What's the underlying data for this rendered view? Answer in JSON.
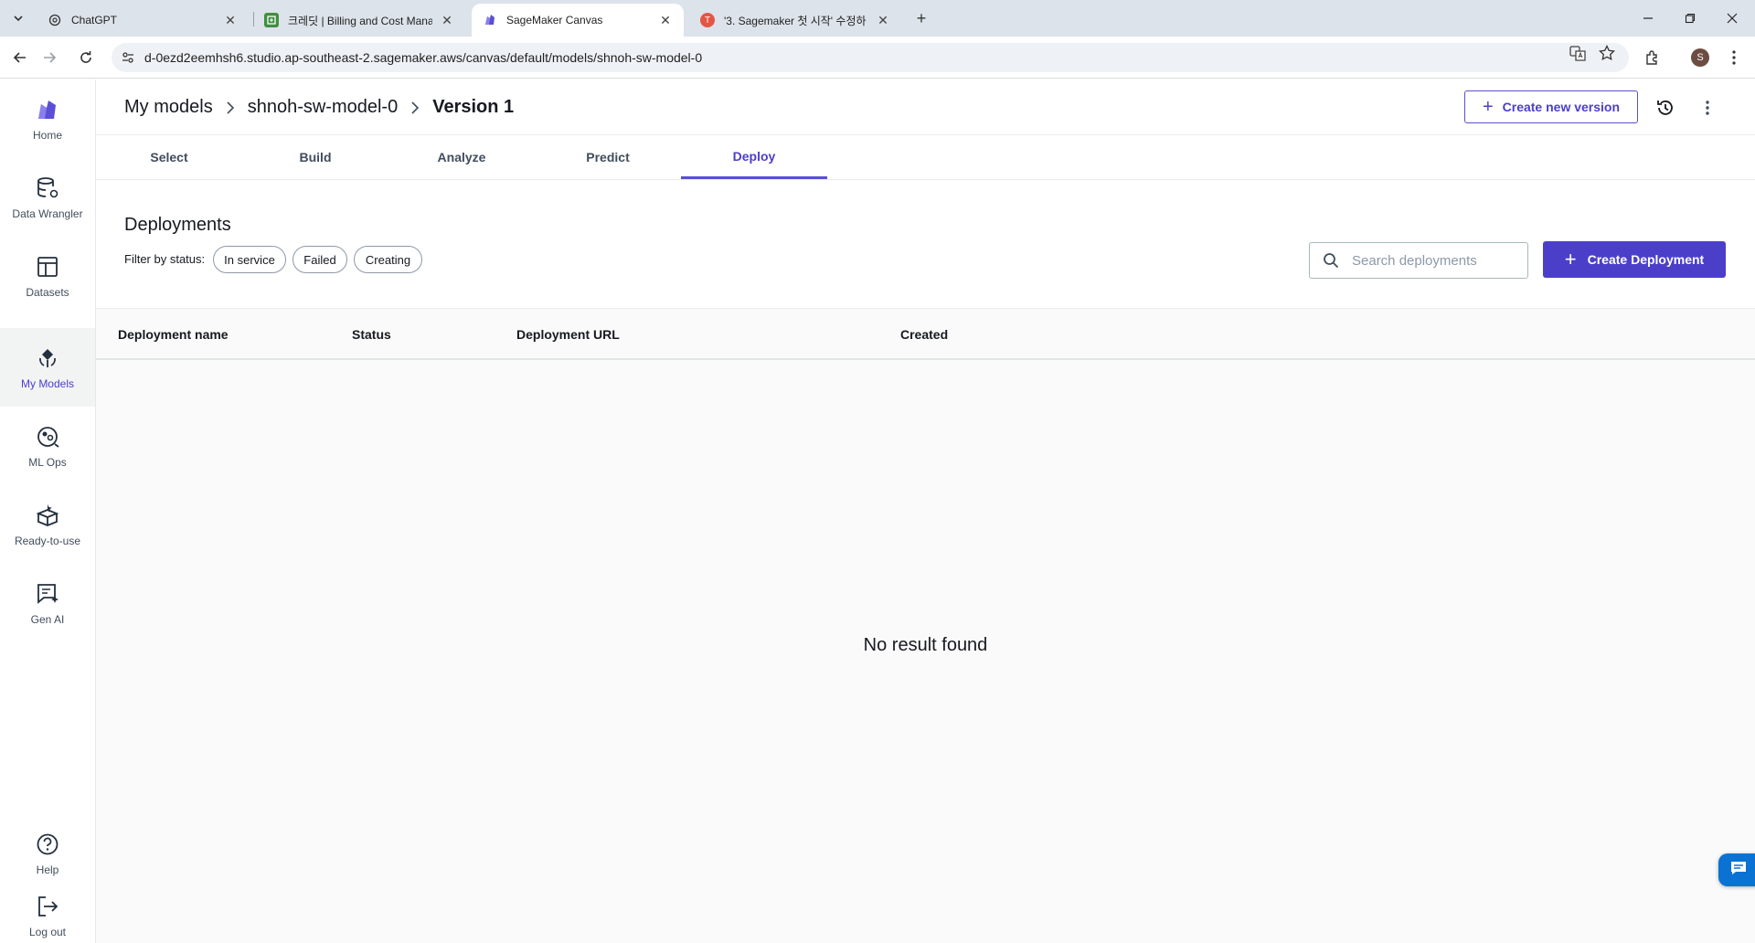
{
  "browser": {
    "tabs": [
      {
        "label": "ChatGPT",
        "active": false
      },
      {
        "label": "크레딧 | Billing and Cost Mana",
        "active": false
      },
      {
        "label": "SageMaker Canvas",
        "active": true
      },
      {
        "label": "'3. Sagemaker 첫 시작' 수정하",
        "active": false
      }
    ],
    "url": "d-0ezd2eemhsh6.studio.ap-southeast-2.sagemaker.aws/canvas/default/models/shnoh-sw-model-0",
    "profile_initial": "S"
  },
  "sidebar": {
    "items": [
      {
        "label": "Home",
        "icon": "canvas-logo-icon"
      },
      {
        "label": "Data Wrangler",
        "icon": "database-icon"
      },
      {
        "label": "Datasets",
        "icon": "table-icon"
      },
      {
        "label": "My Models",
        "icon": "model-icon",
        "active": true
      },
      {
        "label": "ML Ops",
        "icon": "mlops-icon"
      },
      {
        "label": "Ready-to-use",
        "icon": "box-icon"
      },
      {
        "label": "Gen AI",
        "icon": "chat-sparkle-icon"
      }
    ],
    "bottom": [
      {
        "label": "Help",
        "icon": "help-icon"
      },
      {
        "label": "Log out",
        "icon": "logout-icon"
      }
    ]
  },
  "header": {
    "breadcrumb": [
      "My models",
      "shnoh-sw-model-0",
      "Version 1"
    ],
    "create_version_label": "Create new version"
  },
  "workflow_tabs": [
    "Select",
    "Build",
    "Analyze",
    "Predict",
    "Deploy"
  ],
  "active_tab": "Deploy",
  "deployments": {
    "title": "Deployments",
    "filter_label": "Filter by status:",
    "filters": [
      "In service",
      "Failed",
      "Creating"
    ],
    "search_placeholder": "Search deployments",
    "create_label": "Create Deployment",
    "columns": [
      "Deployment name",
      "Status",
      "Deployment URL",
      "Created"
    ],
    "rows": [],
    "empty_message": "No result found"
  },
  "colors": {
    "accent": "#4b3fc9",
    "tab_bar": "#dde3ea",
    "table_bg": "#fafafa"
  }
}
